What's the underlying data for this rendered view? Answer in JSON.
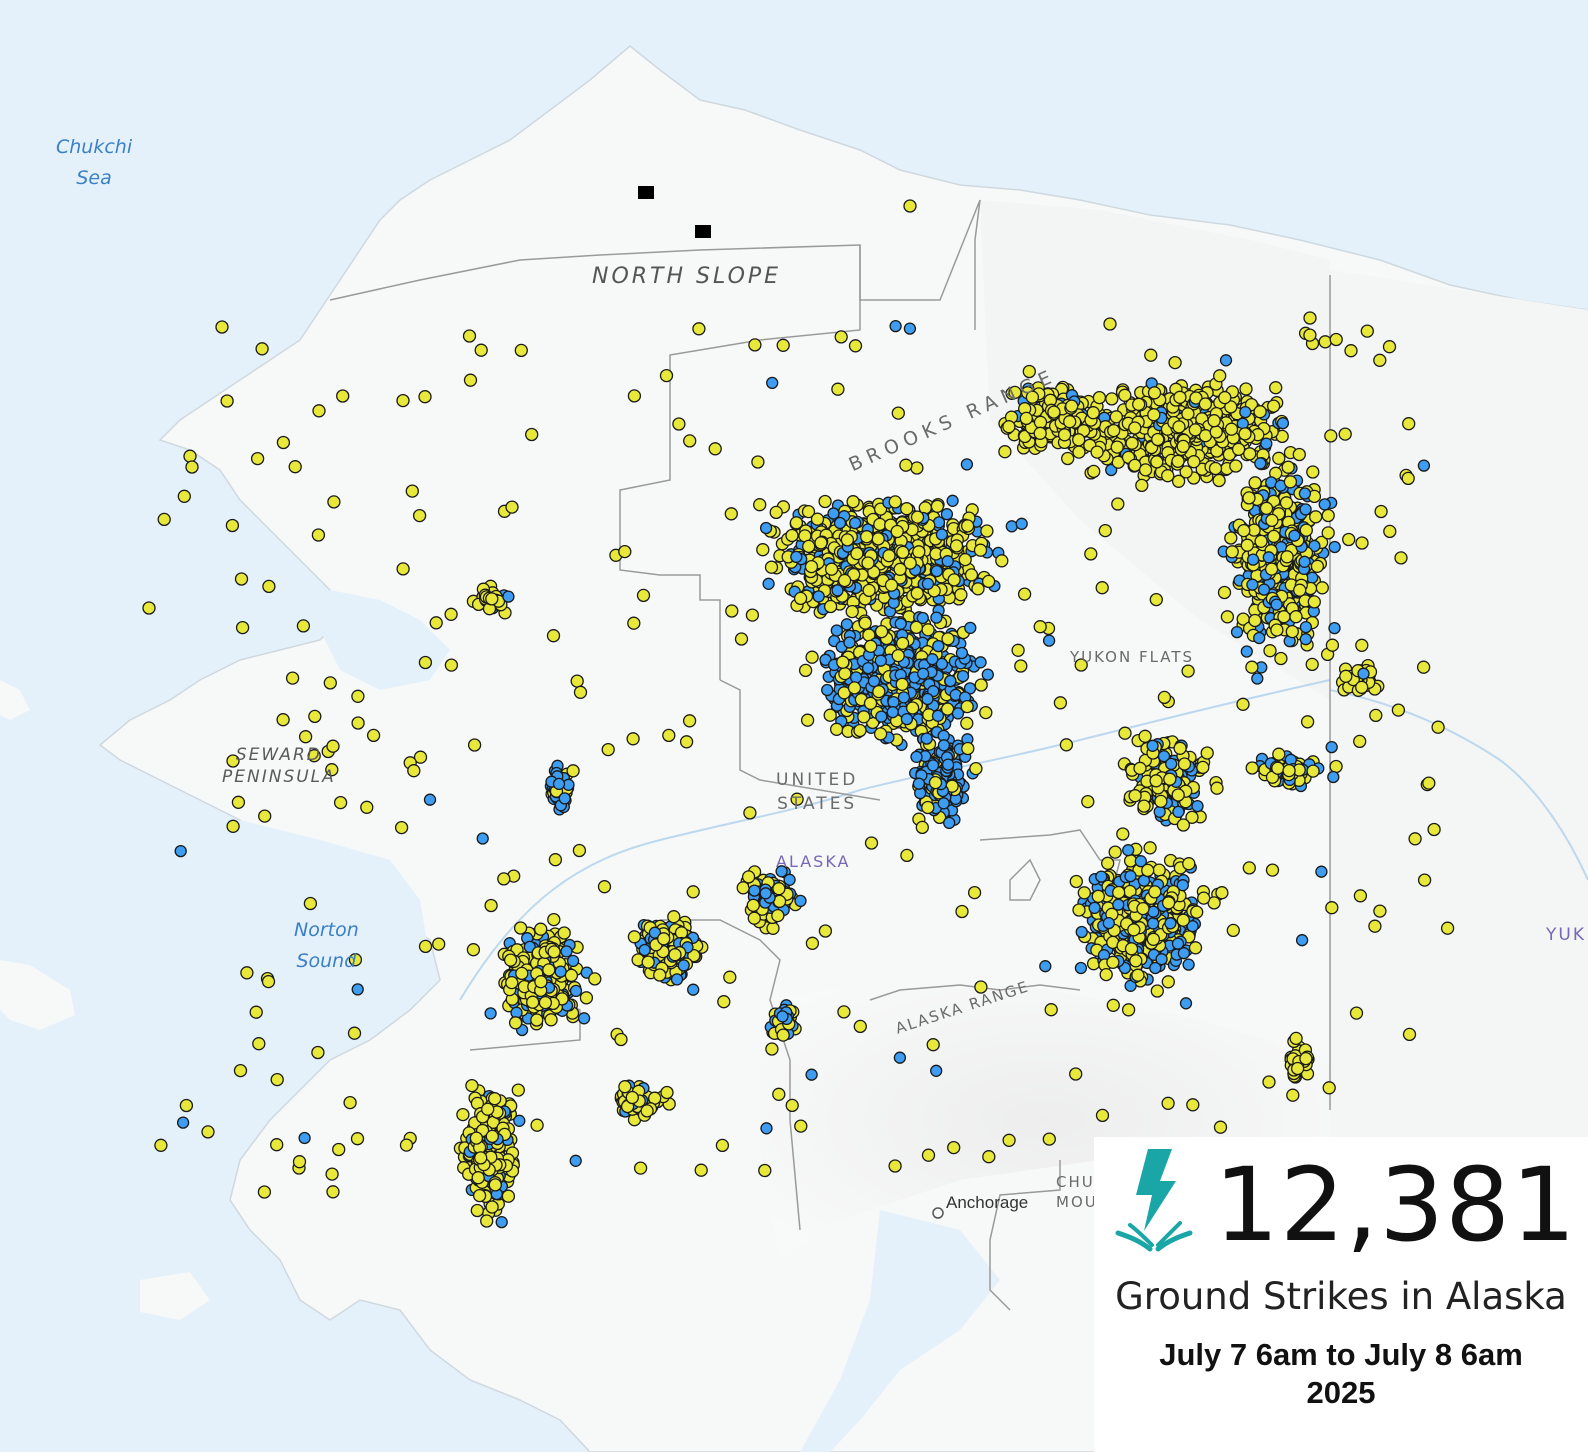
{
  "map": {
    "labels": {
      "chukchi_sea_1": "Chukchi",
      "chukchi_sea_2": "Sea",
      "north_slope": "NORTH SLOPE",
      "brooks_range": "BROOKS RANGE",
      "yukon_flats": "YUKON FLATS",
      "seward_1": "SEWARD",
      "seward_2": "PENINSULA",
      "united_1": "UNITED",
      "united_2": "STATES",
      "alaska": "ALASKA",
      "norton_1": "Norton",
      "norton_2": "Sound",
      "alaska_range": "ALASKA RANGE",
      "anchorage": "Anchorage",
      "chugach_1": "CHU",
      "chugach_2": "MOU",
      "yukon": "YUK"
    },
    "colors": {
      "water": "#e4f1fb",
      "land": "#f7f8f8",
      "strike_yellow": "#e8e83a",
      "strike_blue": "#3d9df2",
      "strike_outline": "#1a1a1a",
      "border": "#9a9a9a"
    },
    "strike_categories": [
      "yellow",
      "blue"
    ]
  },
  "legend": {
    "icon": "lightning-bolt-icon",
    "icon_color": "#1aa6a6",
    "count": "12,381",
    "title": "Ground Strikes in Alaska",
    "date_range": "July 7 6am to July 8 6am",
    "year": "2025"
  }
}
